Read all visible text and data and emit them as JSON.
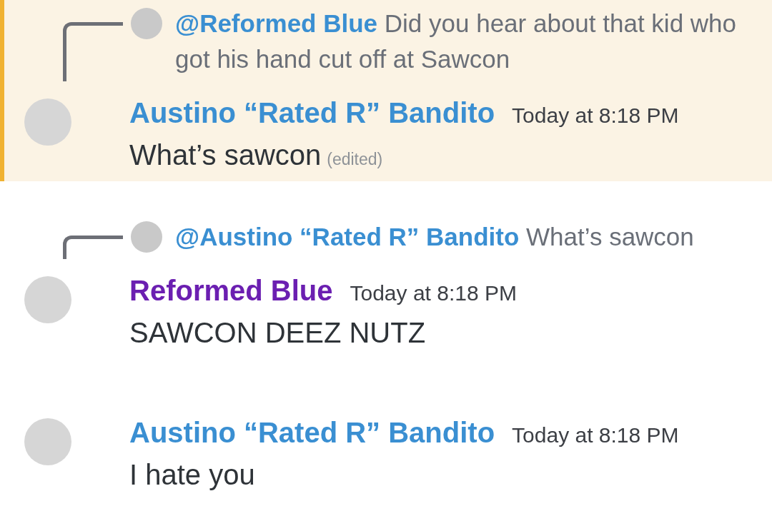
{
  "messages": [
    {
      "highlighted": true,
      "reply": {
        "mention": "@Reformed Blue",
        "text": "Did you hear about that kid who got his hand cut off at Sawcon"
      },
      "author": "Austino “Rated R” Bandito",
      "color": "#3a8fd2",
      "timestamp": "Today at 8:18 PM",
      "content": "What’s sawcon",
      "edited": "(edited)"
    },
    {
      "highlighted": false,
      "reply": {
        "mention": "@Austino “Rated R” Bandito",
        "text": "What’s sawcon"
      },
      "author": "Reformed Blue",
      "color": "#6b1fb1",
      "timestamp": "Today at 8:18 PM",
      "content": "SAWCON DEEZ NUTZ"
    },
    {
      "highlighted": false,
      "author": "Austino “Rated R” Bandito",
      "color": "#3a8fd2",
      "timestamp": "Today at 8:18 PM",
      "content": "I hate you"
    }
  ]
}
